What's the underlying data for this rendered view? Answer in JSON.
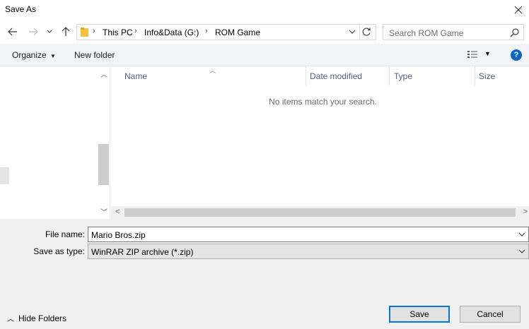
{
  "window": {
    "title": "Save As"
  },
  "address_bar": {
    "crumbs": [
      "This PC",
      "Info&Data (G:)",
      "ROM Game"
    ]
  },
  "search": {
    "placeholder": "Search ROM Game"
  },
  "toolbar": {
    "organize_label": "Organize",
    "new_folder_label": "New folder"
  },
  "columns": [
    "Name",
    "Date modified",
    "Type",
    "Size"
  ],
  "content": {
    "empty_message": "No items match your search."
  },
  "form": {
    "file_name_label": "File name:",
    "file_name_value": "Mario Bros.zip",
    "save_as_type_label": "Save as type:",
    "save_as_type_value": "WinRAR ZIP archive (*.zip)"
  },
  "footer": {
    "hide_folders_label": "Hide Folders",
    "save_label": "Save",
    "cancel_label": "Cancel"
  },
  "colors": {
    "accent": "#0078d7",
    "help": "#0c64c4",
    "column_header": "#4d6082"
  },
  "icons": [
    "close-icon",
    "back-arrow-icon",
    "forward-arrow-icon",
    "recent-locations-icon",
    "up-arrow-icon",
    "folder-icon",
    "refresh-icon",
    "search-icon",
    "view-options-icon",
    "help-icon"
  ]
}
